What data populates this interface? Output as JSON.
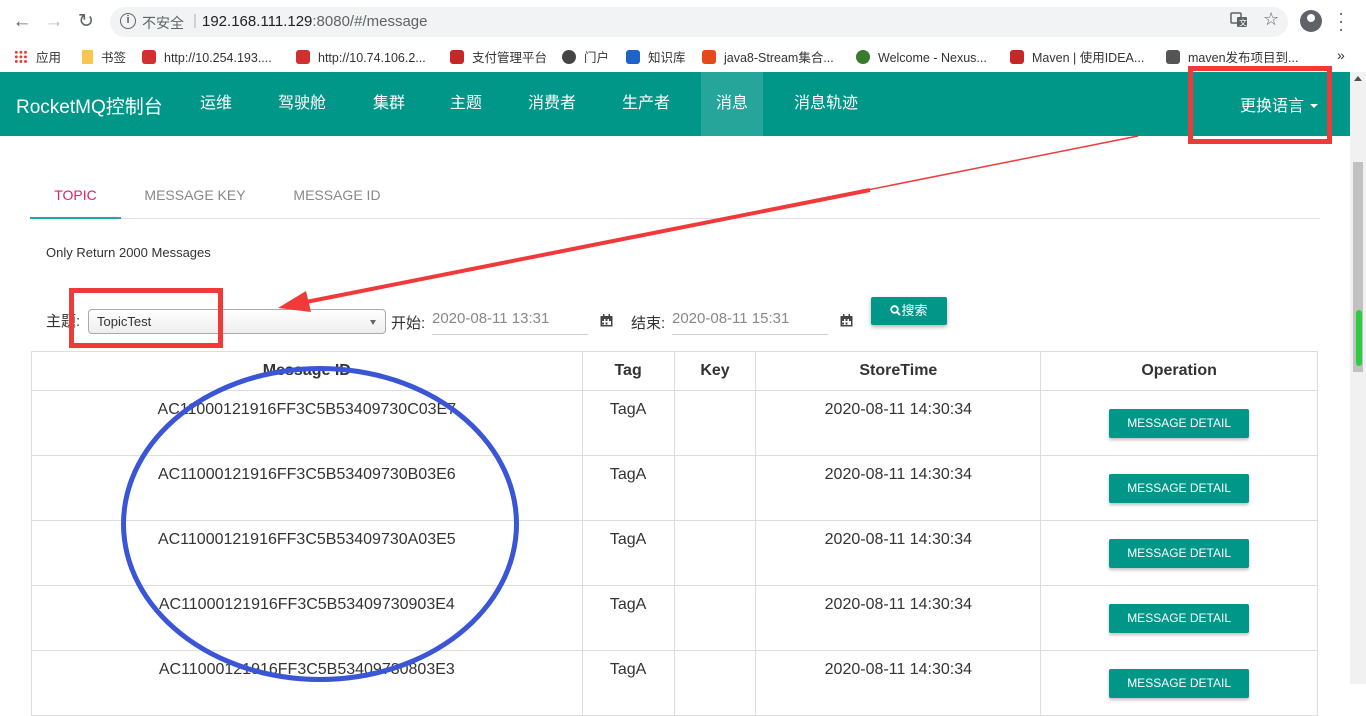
{
  "browser": {
    "insecure_label": "不安全",
    "url_host": "192.168.111.129",
    "url_rest": ":8080/#/message",
    "bookmarks": [
      {
        "label": "应用",
        "color": "#e53935"
      },
      {
        "label": "书签",
        "color": "#f9c74f"
      },
      {
        "label": "http://10.254.193....",
        "color": "#d32f2f"
      },
      {
        "label": "http://10.74.106.2...",
        "color": "#d32f2f"
      },
      {
        "label": "支付管理平台",
        "color": "#c62828"
      },
      {
        "label": "门户",
        "color": "#444444"
      },
      {
        "label": "知识库",
        "color": "#1e63c8"
      },
      {
        "label": "java8-Stream集合...",
        "color": "#e64a19"
      },
      {
        "label": "Welcome - Nexus...",
        "color": "#3a7a2c"
      },
      {
        "label": "Maven | 使用IDEA...",
        "color": "#c62828"
      },
      {
        "label": "maven发布项目到...",
        "color": "#555555"
      }
    ],
    "more": "»"
  },
  "app": {
    "brand": "RocketMQ控制台",
    "nav": [
      "运维",
      "驾驶舱",
      "集群",
      "主题",
      "消费者",
      "生产者",
      "消息",
      "消息轨迹"
    ],
    "active_nav": "消息",
    "lang": "更换语言"
  },
  "tabs": [
    "TOPIC",
    "MESSAGE KEY",
    "MESSAGE ID"
  ],
  "note": "Only Return 2000 Messages",
  "form": {
    "topic_label": "主题:",
    "topic_value": "TopicTest",
    "begin_label": "开始:",
    "begin_value": "2020-08-11 13:31",
    "end_label": "结束:",
    "end_value": "2020-08-11 15:31",
    "search_label": "搜索"
  },
  "table": {
    "headers": [
      "Message ID",
      "Tag",
      "Key",
      "StoreTime",
      "Operation"
    ],
    "rows": [
      {
        "id": "AC11000121916FF3C5B53409730C03E7",
        "tag": "TagA",
        "key": "",
        "time": "2020-08-11 14:30:34",
        "op": "MESSAGE DETAIL"
      },
      {
        "id": "AC11000121916FF3C5B53409730B03E6",
        "tag": "TagA",
        "key": "",
        "time": "2020-08-11 14:30:34",
        "op": "MESSAGE DETAIL"
      },
      {
        "id": "AC11000121916FF3C5B53409730A03E5",
        "tag": "TagA",
        "key": "",
        "time": "2020-08-11 14:30:34",
        "op": "MESSAGE DETAIL"
      },
      {
        "id": "AC11000121916FF3C5B53409730903E4",
        "tag": "TagA",
        "key": "",
        "time": "2020-08-11 14:30:34",
        "op": "MESSAGE DETAIL"
      },
      {
        "id": "AC11000121916FF3C5B53409730803E3",
        "tag": "TagA",
        "key": "",
        "time": "2020-08-11 14:30:34",
        "op": "MESSAGE DETAIL"
      }
    ]
  },
  "colors": {
    "teal": "#009688",
    "annotation_red": "#f03a3a",
    "annotation_blue": "#3a55d6"
  }
}
